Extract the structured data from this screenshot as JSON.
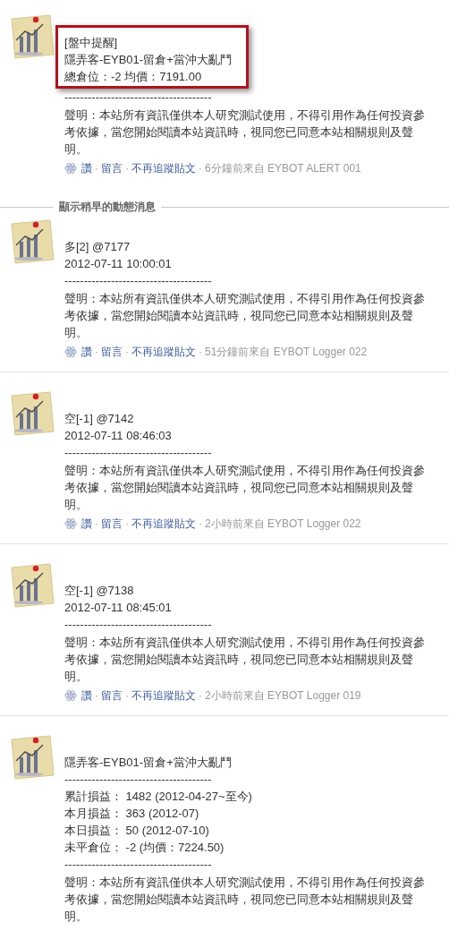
{
  "posts": [
    {
      "alert_box": [
        "[盤中提醒]",
        "隱弄客-EYB01-留倉+當沖大亂鬥",
        "總倉位：-2 均價：7191.00"
      ],
      "lines": [
        "--------------------------------------"
      ],
      "disclaimer": "聲明：本站所有資訊僅供本人研究測試使用，不得引用作為任何投資參考依據，當您開始閱讀本站資訊時，視同您已同意本站相關規則及聲明。",
      "actions": [
        "讚",
        "留言",
        "不再追蹤貼文"
      ],
      "separators": [
        "·",
        "·",
        "·"
      ],
      "meta": "6分鐘前來自 EYBOT ALERT 001"
    },
    {
      "divider": "顯示稍早的動態消息",
      "lines": [
        "多[2] @7177",
        "2012-07-11 10:00:01",
        "--------------------------------------"
      ],
      "disclaimer": "聲明：本站所有資訊僅供本人研究測試使用，不得引用作為任何投資參考依據，當您開始閱讀本站資訊時，視同您已同意本站相關規則及聲明。",
      "actions": [
        "讚",
        "留言",
        "不再追蹤貼文"
      ],
      "separators": [
        "·",
        "·",
        "·"
      ],
      "meta": "51分鐘前來自 EYBOT Logger 022"
    },
    {
      "lines": [
        "空[-1] @7142",
        "2012-07-11 08:46:03",
        "--------------------------------------"
      ],
      "disclaimer": "聲明：本站所有資訊僅供本人研究測試使用，不得引用作為任何投資參考依據，當您開始閱讀本站資訊時，視同您已同意本站相關規則及聲明。",
      "actions": [
        "讚",
        "留言",
        "不再追蹤貼文"
      ],
      "separators": [
        "·",
        "·",
        "·"
      ],
      "meta": "2小時前來自 EYBOT Logger 022"
    },
    {
      "lines": [
        "空[-1] @7138",
        "2012-07-11 08:45:01",
        "--------------------------------------"
      ],
      "disclaimer": "聲明：本站所有資訊僅供本人研究測試使用，不得引用作為任何投資參考依據，當您開始閱讀本站資訊時，視同您已同意本站相關規則及聲明。",
      "actions": [
        "讚",
        "留言",
        "不再追蹤貼文"
      ],
      "separators": [
        "·",
        "·",
        "·"
      ],
      "meta": "2小時前來自 EYBOT Logger 019"
    },
    {
      "lines": [
        "隱弄客-EYB01-留倉+當沖大亂鬥",
        "--------------------------------------",
        "累計損益： 1482 (2012-04-27~至今)",
        "本月損益： 363 (2012-07)",
        "本日損益： 50 (2012-07-10)",
        "未平倉位： -2 (均價：7224.50)",
        "--------------------------------------"
      ],
      "disclaimer": "聲明：本站所有資訊僅供本人研究測試使用，不得引用作為任何投資參考依據，當您開始閱讀本站資訊時，視同您已同意本站相關規則及聲明。"
    }
  ]
}
